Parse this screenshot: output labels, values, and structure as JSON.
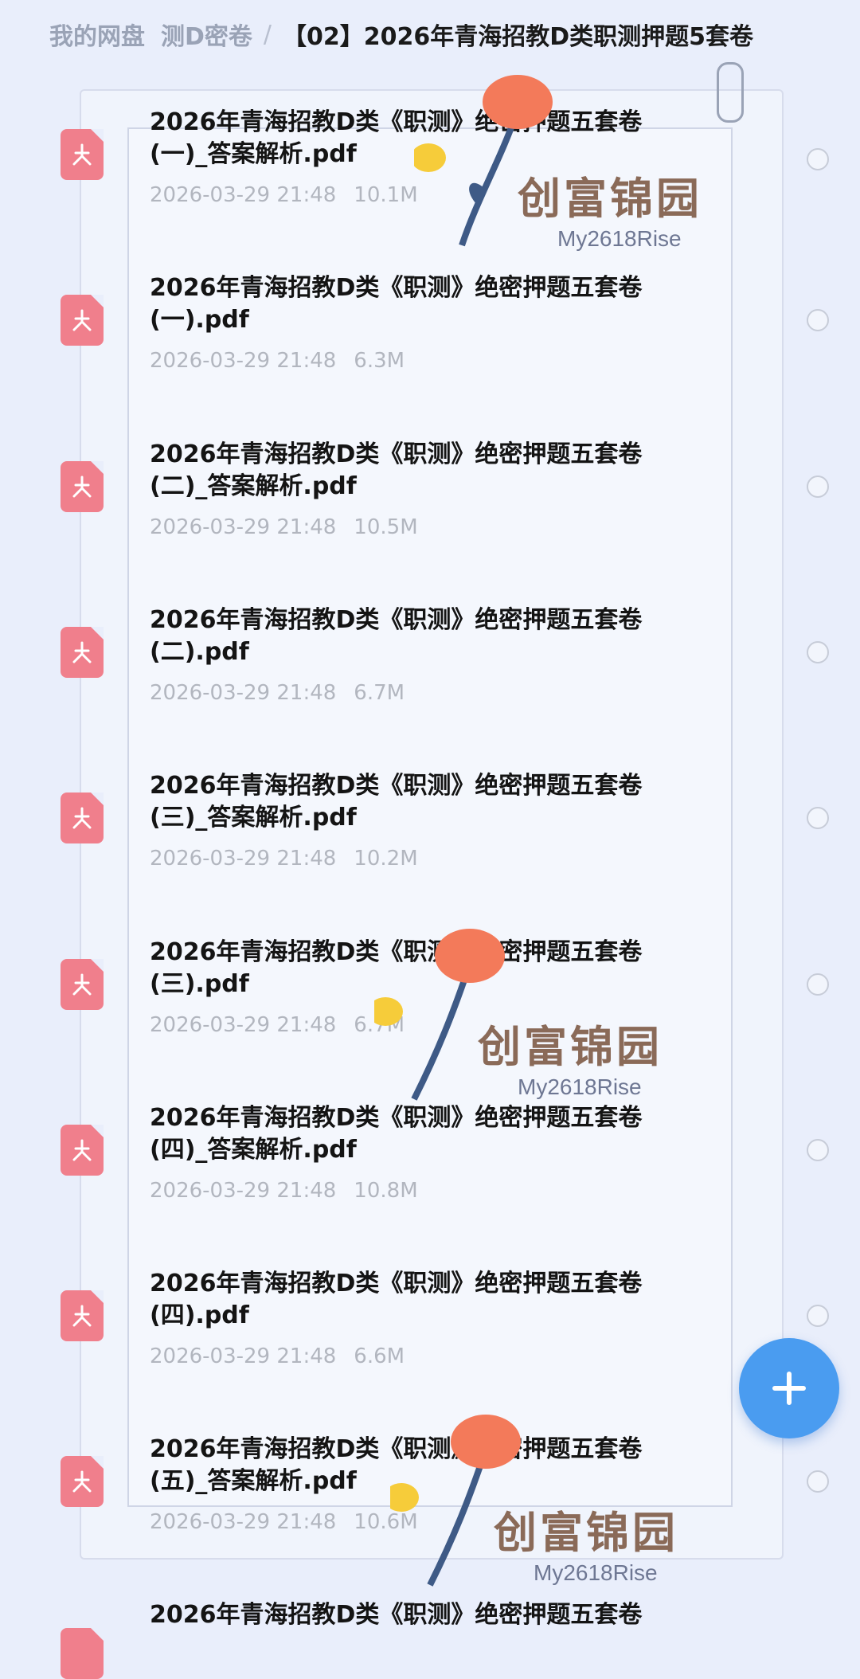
{
  "breadcrumb": {
    "root": "我的网盘",
    "middle": "测D密卷",
    "current": "【02】2026年青海招教D类职测押题5套卷"
  },
  "files": [
    {
      "name": "2026年青海招教D类《职测》绝密押题五套卷\n(一)_答案解析.pdf",
      "date": "2026-03-29 21:48",
      "size": "10.1M"
    },
    {
      "name": "2026年青海招教D类《职测》绝密押题五套卷\n(一).pdf",
      "date": "2026-03-29 21:48",
      "size": "6.3M"
    },
    {
      "name": "2026年青海招教D类《职测》绝密押题五套卷\n(二)_答案解析.pdf",
      "date": "2026-03-29 21:48",
      "size": "10.5M"
    },
    {
      "name": "2026年青海招教D类《职测》绝密押题五套卷\n(二).pdf",
      "date": "2026-03-29 21:48",
      "size": "6.7M"
    },
    {
      "name": "2026年青海招教D类《职测》绝密押题五套卷\n(三)_答案解析.pdf",
      "date": "2026-03-29 21:48",
      "size": "10.2M"
    },
    {
      "name": "2026年青海招教D类《职测》绝密押题五套卷\n(三).pdf",
      "date": "2026-03-29 21:48",
      "size": "6.7M"
    },
    {
      "name": "2026年青海招教D类《职测》绝密押题五套卷\n(四)_答案解析.pdf",
      "date": "2026-03-29 21:48",
      "size": "10.8M"
    },
    {
      "name": "2026年青海招教D类《职测》绝密押题五套卷\n(四).pdf",
      "date": "2026-03-29 21:48",
      "size": "6.6M"
    },
    {
      "name": "2026年青海招教D类《职测》绝密押题五套卷\n(五)_答案解析.pdf",
      "date": "2026-03-29 21:48",
      "size": "10.6M"
    },
    {
      "name": "2026年青海招教D类《职测》绝密押题五套卷",
      "date": "",
      "size": ""
    }
  ],
  "watermark": {
    "title": "创富锦园",
    "handle": "My2618Rise"
  },
  "icons": {
    "file": "pdf-file-icon",
    "add": "plus-icon",
    "select": "radio-circle-icon"
  },
  "colors": {
    "pdf_icon": "#f07f8c",
    "fab": "#4a9cf0"
  }
}
